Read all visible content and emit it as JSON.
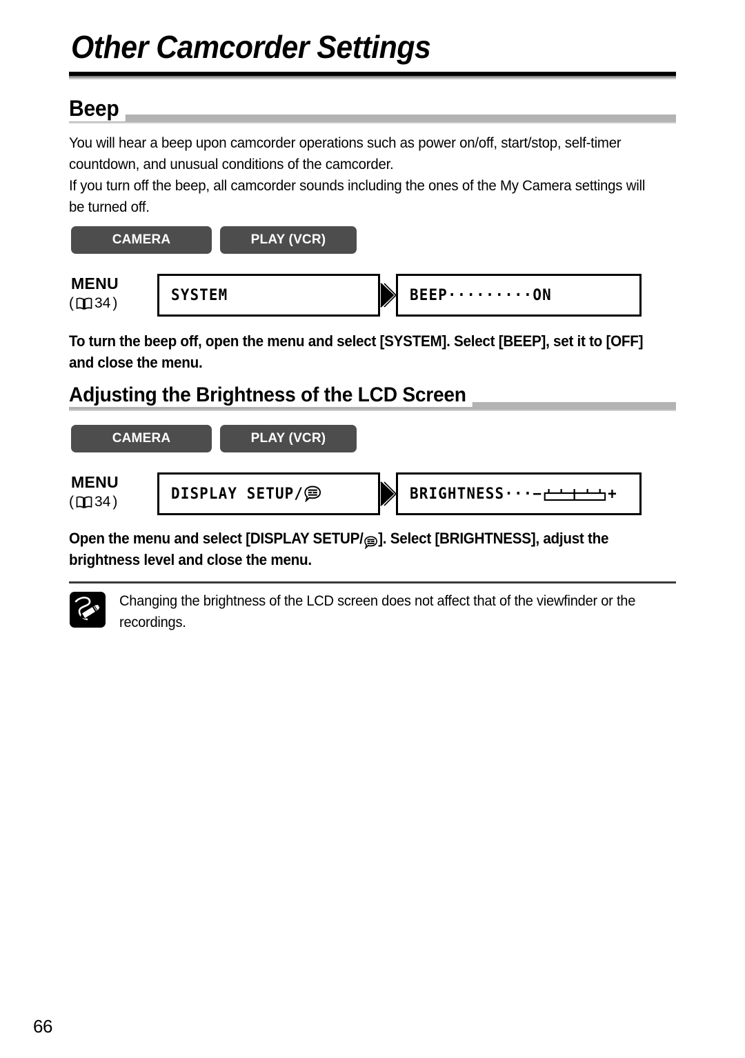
{
  "document": {
    "chapter_title": "Other Camcorder Settings",
    "page_number": "66"
  },
  "sections": [
    {
      "id": "beep",
      "heading": "Beep",
      "paragraphs": [
        "You will hear a beep upon camcorder operations such as power on/off, start/stop, self-timer countdown, and unusual conditions of the camcorder.",
        "If you turn off the beep, all camcorder sounds including the ones of the My Camera settings will be turned off."
      ],
      "modes": {
        "camera_label": "CAMERA",
        "play_label": "PLAY (VCR)"
      },
      "menu": {
        "label": "MENU",
        "ref_open": "(",
        "ref_page": "34",
        "ref_close": ")",
        "ref_icon": "book-icon",
        "box1_text": "SYSTEM",
        "arrow_icon": "right-triangle-arrow-icon",
        "box2_text": "BEEP·········ON"
      },
      "instruction": "To turn the beep off, open the menu and select [SYSTEM]. Select [BEEP], set it to [OFF] and close the menu."
    },
    {
      "id": "brightness",
      "heading": "Adjusting the Brightness of the LCD Screen",
      "modes": {
        "camera_label": "CAMERA",
        "play_label": "PLAY (VCR)"
      },
      "menu": {
        "label": "MENU",
        "ref_open": "(",
        "ref_page": "34",
        "ref_close": ")",
        "ref_icon": "book-icon",
        "box1_text": "DISPLAY SETUP/",
        "box1_icon": "display-language-bubble-icon",
        "arrow_icon": "right-triangle-arrow-icon",
        "box2_text_prefix": "BRIGHTNESS···",
        "box2_minus": "−",
        "box2_slider": "brightness-slider",
        "box2_plus": "+"
      },
      "instruction_part1": "Open the menu and select [DISPLAY SETUP/",
      "instruction_icon": "display-language-bubble-icon",
      "instruction_part2": "]. Select [BRIGHTNESS], adjust the brightness level and close the menu."
    }
  ],
  "note": {
    "icon": "note-pencil-icon",
    "text": "Changing the brightness of the LCD screen does not affect that of the viewfinder or the recordings."
  },
  "colors": {
    "mode_button_bg": "#4d4d4d",
    "mode_button_text": "#ffffff",
    "section_bar": "#b3b3b3",
    "rule_black": "#000000",
    "page_bg": "#ffffff"
  }
}
